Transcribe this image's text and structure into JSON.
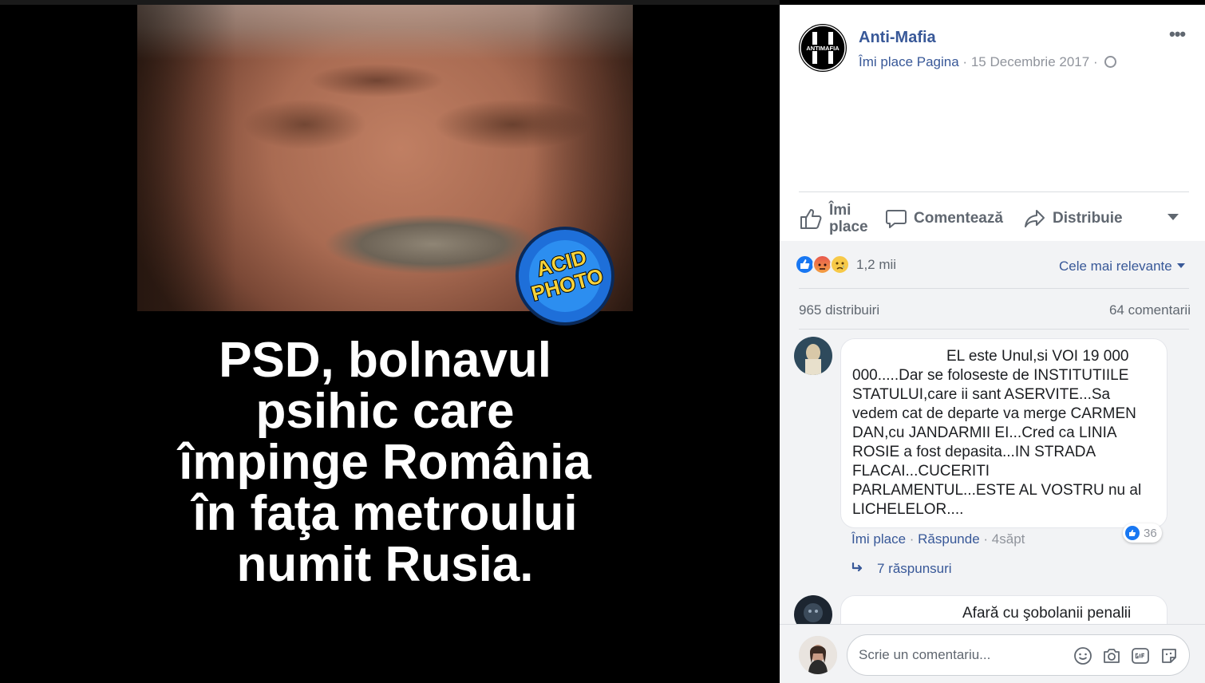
{
  "media": {
    "caption_lines": [
      "PSD, bolnavul",
      "psihic care",
      "împinge România",
      "în faţa metroului",
      "numit Rusia."
    ],
    "watermark_line1": "ACID",
    "watermark_line2": "PHOTO",
    "page_logo_text": "ANTIMAFIA"
  },
  "post": {
    "page_name": "Anti-Mafia",
    "like_page": "Îmi place Pagina",
    "separator": "·",
    "date": "15 Decembrie 2017",
    "more_icon": "more-options-icon"
  },
  "actions": {
    "like_label": "Îmi place",
    "comment_label": "Comentează",
    "share_label": "Distribuie"
  },
  "stats": {
    "reaction_count": "1,2 mii",
    "sort_label": "Cele mai relevante",
    "shares": "965 distribuiri",
    "comments": "64 comentarii"
  },
  "comments": [
    {
      "text": "EL este Unul,si VOI 19 000 000.....Dar se foloseste de INSTITUTIILE STATULUI,care ii sant ASERVITE...Sa vedem cat de departe va merge CARMEN DAN,cu JANDARMII EI...Cred ca LINIA ROSIE a fost depasita...IN STRADA FLACAI...CUCERITI PARLAMENTUL...ESTE AL VOSTRU nu al LICHELELOR....",
      "like_label": "Îmi place",
      "reply_label": "Răspunde",
      "time": "4săpt",
      "likes": "36",
      "replies": "7 răspunsuri"
    },
    {
      "text": "Afară cu şobolanii penalii"
    }
  ],
  "composer": {
    "placeholder": "Scrie un comentariu..."
  },
  "colors": {
    "link": "#385898",
    "muted": "#90949c",
    "like_blue": "#1877f2"
  }
}
